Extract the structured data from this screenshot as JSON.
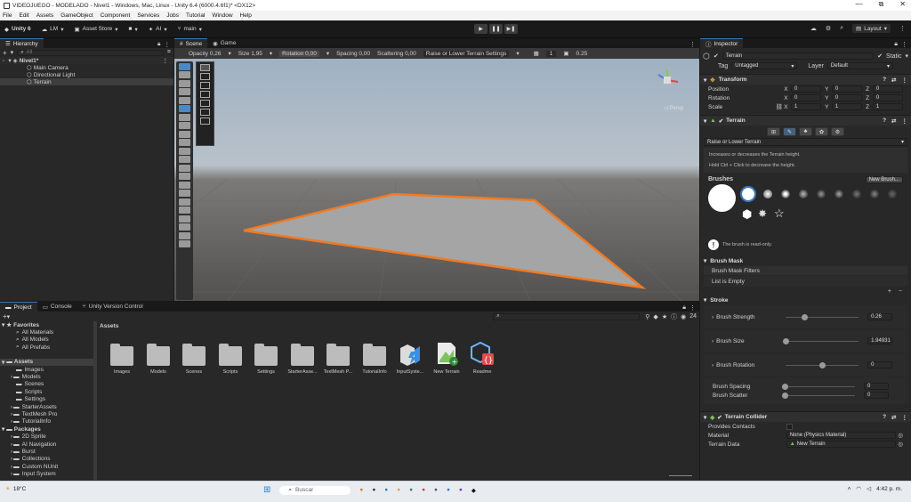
{
  "window": {
    "title": "VIDEOJUEGO - MODELADO - Nivel1 - Windows, Mac, Linux - Unity 6.4 (6000.4.6f1)* <DX12>",
    "controls": [
      "—",
      "⧉",
      "✕"
    ]
  },
  "menu": [
    "File",
    "Edit",
    "Assets",
    "GameObject",
    "Component",
    "Services",
    "Jobs",
    "Tutorial",
    "Window",
    "Help"
  ],
  "toolbar": {
    "unity": "Unity 6",
    "account": "LM",
    "asset_store": "Asset Store",
    "ai": "AI",
    "branch": "main",
    "layout": "Layout"
  },
  "hierarchy": {
    "tab": "Hierarchy",
    "search_placeholder": "All",
    "scene": "Nivel1*",
    "items": [
      "Main Camera",
      "Directional Light",
      "Terrain"
    ]
  },
  "scene": {
    "tabs": [
      "Scene",
      "Game"
    ],
    "toolbar": {
      "opacity": "Opacity 0,26",
      "size": "Size 1,95",
      "rotation": "Rotation 0,00",
      "spacing": "Spacing 0,00",
      "scattering": "Scattering 0,00",
      "mode": "Raise or Lower Terrain Settings",
      "count": "1",
      "value": "0.25"
    },
    "persp": "◁ Persp"
  },
  "inspector": {
    "tab": "Inspector",
    "object_name": "Terrain",
    "static": "Static",
    "tag_label": "Tag",
    "tag": "Untagged",
    "layer_label": "Layer",
    "layer": "Default",
    "transform": {
      "title": "Transform",
      "rows": [
        {
          "label": "Position",
          "x": "0",
          "y": "0",
          "z": "0"
        },
        {
          "label": "Rotation",
          "x": "0",
          "y": "0",
          "z": "0"
        },
        {
          "label": "Scale",
          "x": "1",
          "y": "1",
          "z": "1"
        }
      ]
    },
    "terrain": {
      "title": "Terrain",
      "tool": "Raise or Lower Terrain",
      "help1": "Increases or decreases the Terrain height.",
      "help2": "Hold Ctrl + Click to decrease the height.",
      "brushes_label": "Brushes",
      "new_brush": "New Brush...",
      "readonly": "The brush is read-only.",
      "brush_mask": "Brush Mask",
      "mask_filters": "Brush Mask Filters",
      "list_empty": "List is Empty",
      "stroke": "Stroke",
      "brush_strength_label": "Brush Strength",
      "brush_strength": "0.26",
      "brush_strength_level": 0.26,
      "brush_size_label": "Brush Size",
      "brush_size": "1.94931",
      "brush_size_level": 0.0,
      "brush_rotation_label": "Brush Rotation",
      "brush_rotation": "0",
      "brush_rotation_level": 0.5,
      "brush_spacing_label": "Brush Spacing",
      "brush_spacing": "0",
      "brush_scatter_label": "Brush Scatter",
      "brush_scatter": "0"
    },
    "collider": {
      "title": "Terrain Collider",
      "provides_contacts": "Provides Contacts",
      "material_label": "Material",
      "material": "None (Physics Material)",
      "terrain_data_label": "Terrain Data",
      "terrain_data": "New Terrain"
    }
  },
  "project": {
    "tabs": [
      "Project",
      "Console",
      "Unity Version Control"
    ],
    "favorites": "Favorites",
    "favorite_items": [
      "All Materials",
      "All Models",
      "All Prefabs"
    ],
    "assets_root": "Assets",
    "asset_folders": [
      "Images",
      "Models",
      "Scenes",
      "Scripts",
      "Settings",
      "StarterAssets",
      "TextMesh Pro",
      "TutorialInfo"
    ],
    "packages": "Packages",
    "package_items": [
      "2D Sprite",
      "AI Navigation",
      "Burst",
      "Collections",
      "Custom NUnit",
      "Input System"
    ],
    "breadcrumb": "Assets",
    "count": "24",
    "grid_items": [
      "Images",
      "Models",
      "Scenes",
      "Scripts",
      "Settings",
      "StarterAsse...",
      "TextMesh P...",
      "TutorialInfo",
      "InputSyste...",
      "New Terrain",
      "Readme"
    ]
  },
  "taskbar": {
    "weather": "18°C",
    "search": "Buscar",
    "time": "4:42 p. m."
  }
}
